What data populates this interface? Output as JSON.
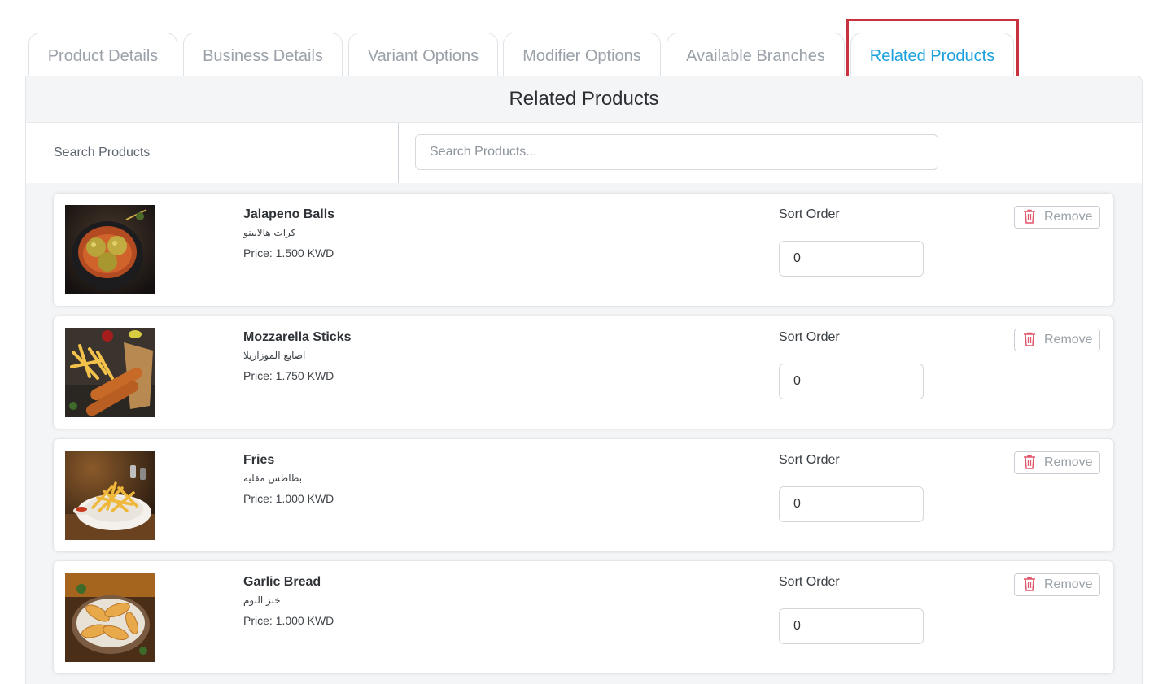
{
  "tabs": [
    {
      "label": "Product Details"
    },
    {
      "label": "Business Details"
    },
    {
      "label": "Variant Options"
    },
    {
      "label": "Modifier Options"
    },
    {
      "label": "Available Branches"
    },
    {
      "label": "Related Products",
      "active": true
    }
  ],
  "panel": {
    "title": "Related Products",
    "search_label": "Search Products",
    "search_placeholder": "Search Products...",
    "search_value": ""
  },
  "products": [
    {
      "name": "Jalapeno Balls",
      "name_ar": "كرات هالابينو",
      "price": "Price: 1.500 KWD",
      "sort_label": "Sort Order",
      "sort_value": "0",
      "remove_label": "Remove"
    },
    {
      "name": "Mozzarella Sticks",
      "name_ar": "اصابع الموزاريلا",
      "price": "Price: 1.750 KWD",
      "sort_label": "Sort Order",
      "sort_value": "0",
      "remove_label": "Remove"
    },
    {
      "name": "Fries",
      "name_ar": "بطاطس مقلية",
      "price": "Price: 1.000 KWD",
      "sort_label": "Sort Order",
      "sort_value": "0",
      "remove_label": "Remove"
    },
    {
      "name": "Garlic Bread",
      "name_ar": "خبز الثوم",
      "price": "Price: 1.000 KWD",
      "sort_label": "Sort Order",
      "sort_value": "0",
      "remove_label": "Remove"
    }
  ],
  "icons": {
    "remove": "trash-icon"
  },
  "colors": {
    "active_tab": "#1aa0dc",
    "highlight": "#c8323f",
    "remove_icon": "#e0576b"
  }
}
